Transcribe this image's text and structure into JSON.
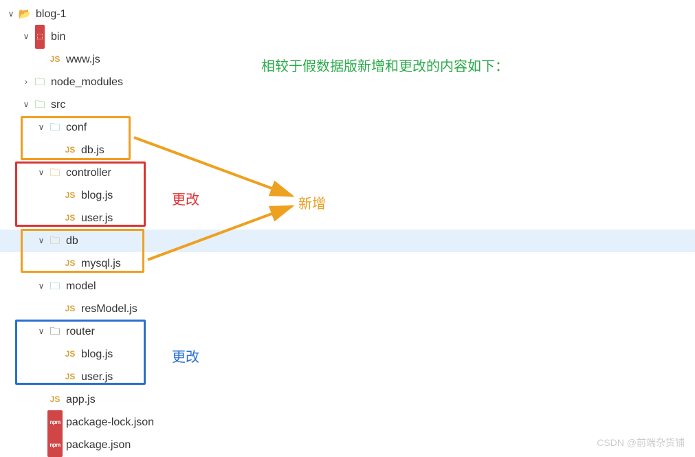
{
  "title": "相较于假数据版新增和更改的内容如下：",
  "labels": {
    "change_red": "更改",
    "change_blue": "更改",
    "new": "新增"
  },
  "watermark": "CSDN @前端杂货铺",
  "tree": {
    "root": "blog-1",
    "bin": "bin",
    "www": "www.js",
    "node_modules": "node_modules",
    "src": "src",
    "conf": "conf",
    "db_conf": "db.js",
    "controller": "controller",
    "ctrl_blog": "blog.js",
    "ctrl_user": "user.js",
    "db": "db",
    "mysql": "mysql.js",
    "model": "model",
    "resModel": "resModel.js",
    "router": "router",
    "router_blog": "blog.js",
    "router_user": "user.js",
    "app": "app.js",
    "pkglock": "package-lock.json",
    "pkg": "package.json"
  }
}
